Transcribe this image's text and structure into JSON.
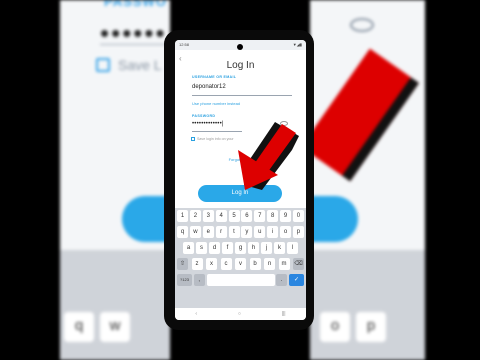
{
  "background": {
    "password_label": "PASSWO",
    "password_dots": "••••••",
    "save_text": "Save L",
    "keys_row1": [
      "q",
      "w",
      "o",
      "p"
    ]
  },
  "status": {
    "time": "12:58",
    "icons": "▼◢▮"
  },
  "login": {
    "title": "Log In",
    "username_label": "USERNAME OR EMAIL",
    "username_value": "deponator12",
    "phone_link": "Use phone number instead",
    "password_label": "PASSWORD",
    "password_value": "•••••••••••••|",
    "save_login": "Save login info on your",
    "forgot": "Forgot your p",
    "button": "Log In"
  },
  "keyboard": {
    "row1": [
      "1",
      "2",
      "3",
      "4",
      "5",
      "6",
      "7",
      "8",
      "9",
      "0"
    ],
    "row2": [
      "q",
      "w",
      "e",
      "r",
      "t",
      "y",
      "u",
      "i",
      "o",
      "p"
    ],
    "row3": [
      "a",
      "s",
      "d",
      "f",
      "g",
      "h",
      "j",
      "k",
      "l"
    ],
    "row4": [
      "⇧",
      "z",
      "x",
      "c",
      "v",
      "b",
      "n",
      "m",
      "⌫"
    ],
    "row5_left": "?123",
    "row5_comma": ",",
    "row5_dot": ".",
    "row5_enter": "✓"
  },
  "nav": [
    "‹",
    "○",
    "|||"
  ],
  "colors": {
    "accent": "#2aa8e8",
    "arrow": "#dd0000"
  }
}
